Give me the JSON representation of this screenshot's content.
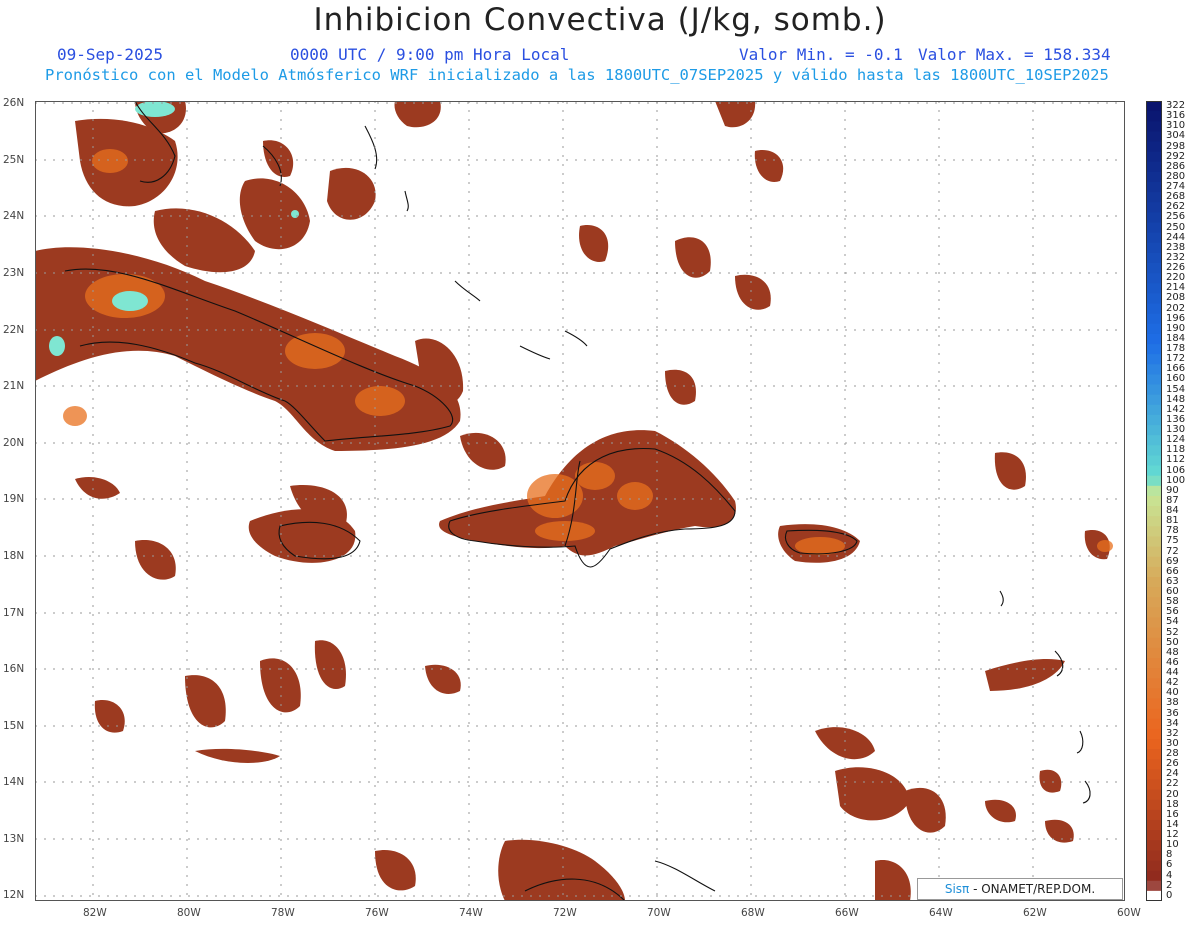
{
  "header": {
    "title": "Inhibicion Convectiva (J/kg, somb.)",
    "date": "09-Sep-2025",
    "time": "0000 UTC / 9:00 pm Hora Local",
    "valmin": "Valor Min. = -0.1",
    "valmax": "Valor Max. = 158.334",
    "forecast": "Pronóstico con el Modelo Atmósferico WRF inicializado a las 1800UTC_07SEP2025 y válido hasta las  1800UTC_10SEP2025"
  },
  "map": {
    "lon_labels": [
      "82W",
      "80W",
      "78W",
      "76W",
      "74W",
      "72W",
      "70W",
      "68W",
      "66W",
      "64W",
      "62W",
      "60W"
    ],
    "lat_labels": [
      "26N",
      "25N",
      "24N",
      "23N",
      "22N",
      "21N",
      "20N",
      "19N",
      "18N",
      "17N",
      "16N",
      "15N",
      "14N",
      "13N",
      "12N"
    ],
    "field_color": "#9c3a20",
    "hot_color": "#e8701e",
    "peak_color": "#7fe6d2",
    "grid_color": "#9a9a9a"
  },
  "colorbar": {
    "labels": [
      "322",
      "316",
      "310",
      "304",
      "298",
      "292",
      "286",
      "280",
      "274",
      "268",
      "262",
      "256",
      "250",
      "244",
      "238",
      "232",
      "226",
      "220",
      "214",
      "208",
      "202",
      "196",
      "190",
      "184",
      "178",
      "172",
      "166",
      "160",
      "154",
      "148",
      "142",
      "136",
      "130",
      "124",
      "118",
      "112",
      "106",
      "100",
      "90",
      "87",
      "84",
      "81",
      "78",
      "75",
      "72",
      "69",
      "66",
      "63",
      "60",
      "58",
      "56",
      "54",
      "52",
      "50",
      "48",
      "46",
      "44",
      "42",
      "40",
      "38",
      "36",
      "34",
      "32",
      "30",
      "28",
      "26",
      "24",
      "22",
      "20",
      "18",
      "16",
      "14",
      "12",
      "10",
      "8",
      "6",
      "4",
      "2",
      "0"
    ]
  },
  "credit": {
    "sis": "Sisπ",
    "text": " - ONAMET/REP.DOM."
  }
}
